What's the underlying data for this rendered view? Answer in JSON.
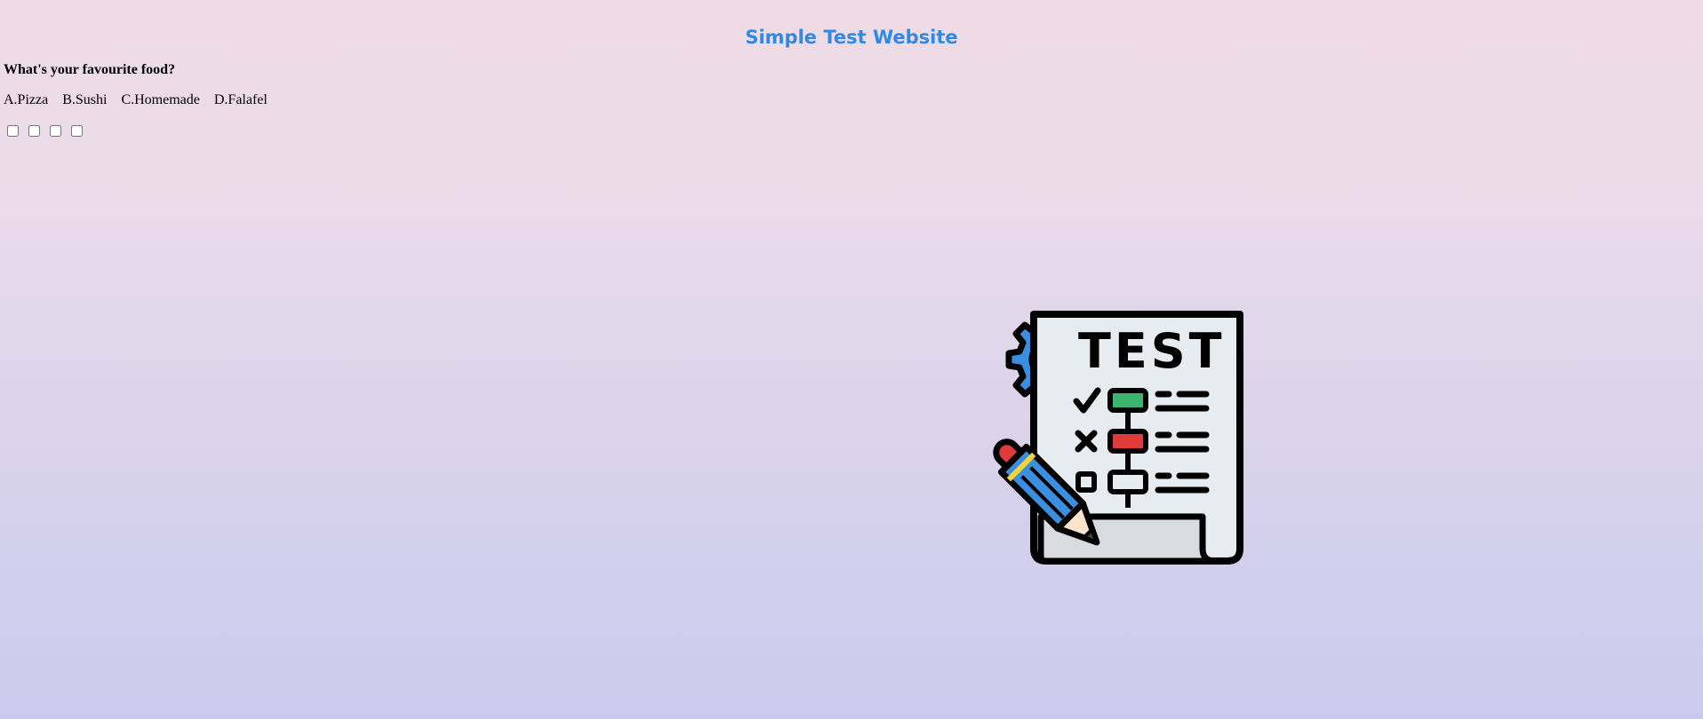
{
  "page": {
    "title": "Simple Test Website"
  },
  "quiz": {
    "question": "What's your favourite food?",
    "options": [
      {
        "label": "A.Pizza",
        "checked": false
      },
      {
        "label": "B.Sushi",
        "checked": false
      },
      {
        "label": "C.Homemade",
        "checked": false
      },
      {
        "label": "D.Falafel",
        "checked": false
      }
    ]
  },
  "illustration": {
    "text": "TEST",
    "icon": "test-paper-pencil-gear-icon",
    "colors": {
      "gear": "#3b8fe0",
      "paper": "#e6ecf0",
      "outline": "#000000",
      "check_box": "#3cb56e",
      "cross_box": "#e03a3a",
      "pencil_body": "#3b8fe0",
      "pencil_eraser": "#e03a3a",
      "pencil_band": "#f5d33c",
      "pencil_wood": "#fde3cc",
      "paper_fold": "#d9dcdf"
    }
  }
}
